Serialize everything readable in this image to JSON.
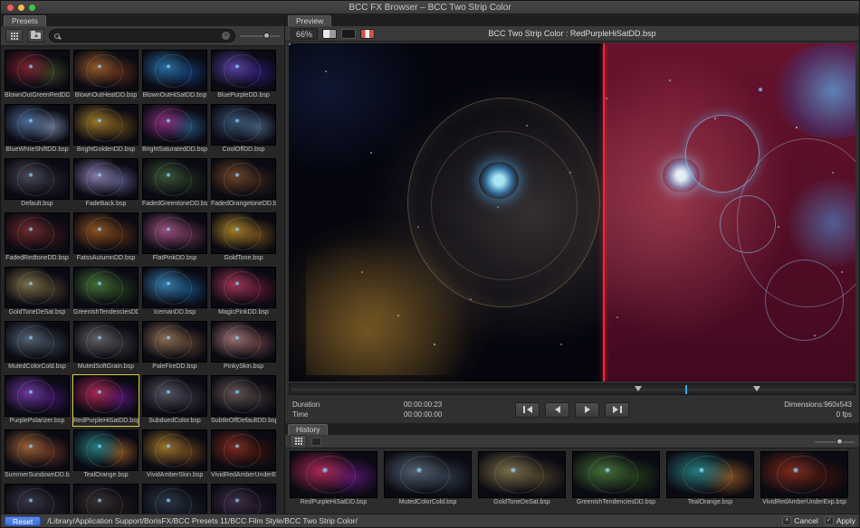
{
  "window": {
    "title": "BCC FX Browser – BCC Two Strip Color"
  },
  "colors": {
    "selection_outline": "#e0d04a",
    "split_line": "#ff2430",
    "reset_button": "#3a6cd4",
    "playhead_tick": "#39a7e8"
  },
  "icons": {
    "clear_glyph": "×",
    "cancel_glyph": "×",
    "apply_glyph": "✓"
  },
  "presets_panel": {
    "tab_label": "Presets",
    "search": {
      "placeholder": "",
      "value": ""
    },
    "items": [
      {
        "label": "BlownOutGreenRedDD.bsp",
        "tint1": "#8a2430",
        "tint2": "#46522a"
      },
      {
        "label": "BlownOutHeatDD.bsp",
        "tint1": "#a8622a",
        "tint2": "#6e3418"
      },
      {
        "label": "BlownOutHiSatDD.bsp",
        "tint1": "#2a7ab8",
        "tint2": "#14488c"
      },
      {
        "label": "BluePurpleDD.bsp",
        "tint1": "#6246b4",
        "tint2": "#33208a"
      },
      {
        "label": "BlueWhiteShiftDD.bsp",
        "tint1": "#5878a8",
        "tint2": "#8fa2c2"
      },
      {
        "label": "BrightGoldenDD.bsp",
        "tint1": "#b08428",
        "tint2": "#7a5418"
      },
      {
        "label": "BrightSaturatedDD.bsp",
        "tint1": "#96348c",
        "tint2": "#2a6a9a"
      },
      {
        "label": "CoolOffDD.bsp",
        "tint1": "#3c5c80",
        "tint2": "#5a7a9e"
      },
      {
        "label": "Default.bsp",
        "tint1": "#50505e",
        "tint2": "#2c2c3a"
      },
      {
        "label": "FadeBack.bsp",
        "tint1": "#9a8cc0",
        "tint2": "#6a6aa0"
      },
      {
        "label": "FadedGreentoneDD.bsp",
        "tint1": "#3e5c3a",
        "tint2": "#24341f"
      },
      {
        "label": "FadedOrangetoneDD.bsp",
        "tint1": "#7a4a28",
        "tint2": "#46281a"
      },
      {
        "label": "FadedRedtoneDD.bsp",
        "tint1": "#7c2c2c",
        "tint2": "#441a1a"
      },
      {
        "label": "FatssAutumnDD.bsp",
        "tint1": "#a05a20",
        "tint2": "#643410"
      },
      {
        "label": "FlatPinkDD.bsp",
        "tint1": "#b05a8c",
        "tint2": "#77385c"
      },
      {
        "label": "GoldTone.bsp",
        "tint1": "#bc9028",
        "tint2": "#8a5a18"
      },
      {
        "label": "GoldToneDeSat.bsp",
        "tint1": "#8c7c4c",
        "tint2": "#564a2c"
      },
      {
        "label": "GreenishTendenciesDD.bsp",
        "tint1": "#4a7c38",
        "tint2": "#2a4a1e"
      },
      {
        "label": "IcemanDD.bsp",
        "tint1": "#3a8cc0",
        "tint2": "#195a90"
      },
      {
        "label": "MagicPinkDD.bsp",
        "tint1": "#b4385c",
        "tint2": "#7a1a3c"
      },
      {
        "label": "MutedColorCold.bsp",
        "tint1": "#5c6c7c",
        "tint2": "#3a4856"
      },
      {
        "label": "MutedSoftGrain.bsp",
        "tint1": "#6e6e6e",
        "tint2": "#454545"
      },
      {
        "label": "PaleFireDD.bsp",
        "tint1": "#9e7c5a",
        "tint2": "#6a4a34"
      },
      {
        "label": "PinkySkin.bsp",
        "tint1": "#b27e7e",
        "tint2": "#7a4a4a"
      },
      {
        "label": "PurplePolarizer.bsp",
        "tint1": "#7c3cb4",
        "tint2": "#48187c"
      },
      {
        "label": "RedPurpleHiSatDD.bsp",
        "tint1": "#c02a5e",
        "tint2": "#6e1a90",
        "selected": true
      },
      {
        "label": "SubduedColor.bsp",
        "tint1": "#5e5e6e",
        "tint2": "#3a3a48"
      },
      {
        "label": "SubtleOffDefaultDD.bsp",
        "tint1": "#6e5e5a",
        "tint2": "#463836"
      },
      {
        "label": "SummerSundownDD.bsp",
        "tint1": "#b06a38",
        "tint2": "#7a3a24"
      },
      {
        "label": "TealOrange.bsp",
        "tint1": "#2a8a8a",
        "tint2": "#b06a28"
      },
      {
        "label": "VividAmberSkin.bsp",
        "tint1": "#b4822a",
        "tint2": "#7c4c18"
      },
      {
        "label": "VividRedAmberUnderExp.bsp",
        "tint1": "#8c2c18",
        "tint2": "#45140a"
      },
      {
        "label": "",
        "tint1": "#3c3a4c",
        "tint2": "#232230"
      },
      {
        "label": "",
        "tint1": "#3c3230",
        "tint2": "#241d1c"
      },
      {
        "label": "",
        "tint1": "#2c3a4c",
        "tint2": "#1a2430"
      },
      {
        "label": "",
        "tint1": "#44304c",
        "tint2": "#281c30"
      }
    ]
  },
  "preview_panel": {
    "tab_label": "Preview",
    "zoom_value": "66%",
    "title": "BCC Two Strip Color : RedPurpleHiSatDD.bsp",
    "transport": {
      "duration_label": "Duration",
      "duration": "00:00:00:23",
      "time_label": "Time",
      "time": "00:00:00:00",
      "dimensions": "Dimensions:960x543",
      "fps": "0 fps"
    }
  },
  "history_panel": {
    "tab_label": "History",
    "items": [
      {
        "label": "RedPurpleHiSatDD.bsp",
        "tint1": "#c02a5e",
        "tint2": "#6e1a90"
      },
      {
        "label": "MutedColorCold.bsp",
        "tint1": "#5c6c7c",
        "tint2": "#3a4856"
      },
      {
        "label": "GoldToneDeSat.bsp",
        "tint1": "#8c7c4c",
        "tint2": "#564a2c"
      },
      {
        "label": "GreenishTendenciesDD.bsp",
        "tint1": "#4a7c38",
        "tint2": "#2a4a1e"
      },
      {
        "label": "TealOrange.bsp",
        "tint1": "#2a8a8a",
        "tint2": "#b06a28"
      },
      {
        "label": "VividRedAmberUnderExp.bsp",
        "tint1": "#8c2c18",
        "tint2": "#45140a"
      }
    ]
  },
  "status_bar": {
    "reset_label": "Reset",
    "path": "/Library/Application Support/BorisFX/BCC Presets 11/BCC Film Style/BCC Two Strip Color/",
    "cancel_label": "Cancel",
    "apply_label": "Apply"
  }
}
